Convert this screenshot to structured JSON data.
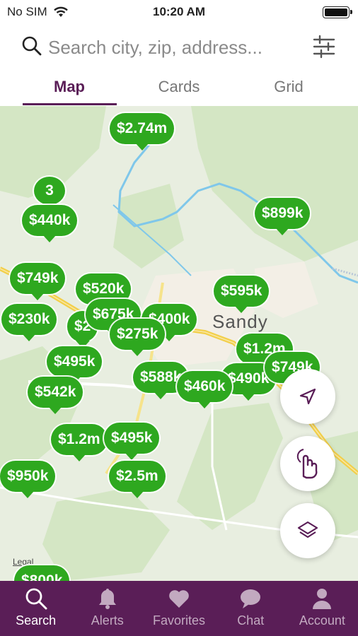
{
  "status_bar": {
    "carrier": "No SIM",
    "time": "10:20 AM"
  },
  "search": {
    "placeholder": "Search city, zip, address..."
  },
  "tabs": [
    {
      "label": "Map",
      "active": true
    },
    {
      "label": "Cards",
      "active": false
    },
    {
      "label": "Grid",
      "active": false
    }
  ],
  "map": {
    "town_label": "Sandy",
    "attribution": "Legal",
    "cluster_count": "3",
    "pins": [
      "$2.74m",
      "$440k",
      "$899k",
      "$749k",
      "$520k",
      "$595k",
      "$230k",
      "$675k",
      "$400k",
      "$2",
      "$275k",
      "$1.2m",
      "$495k",
      "$588k",
      "$490k",
      "$749k",
      "$460k",
      "$542k",
      "$1.2m",
      "$495k",
      "$950k",
      "$2.5m",
      "$800k"
    ],
    "controls": [
      "location-arrow-icon",
      "draw-hand-icon",
      "layers-icon"
    ]
  },
  "bottom_nav": [
    {
      "label": "Search",
      "icon": "search-icon",
      "active": true
    },
    {
      "label": "Alerts",
      "icon": "bell-icon",
      "active": false
    },
    {
      "label": "Favorites",
      "icon": "heart-icon",
      "active": false
    },
    {
      "label": "Chat",
      "icon": "chat-bubble-icon",
      "active": false
    },
    {
      "label": "Account",
      "icon": "person-icon",
      "active": false
    }
  ],
  "colors": {
    "brand_purple": "#5a1e57",
    "pin_green": "#2ea81f"
  }
}
